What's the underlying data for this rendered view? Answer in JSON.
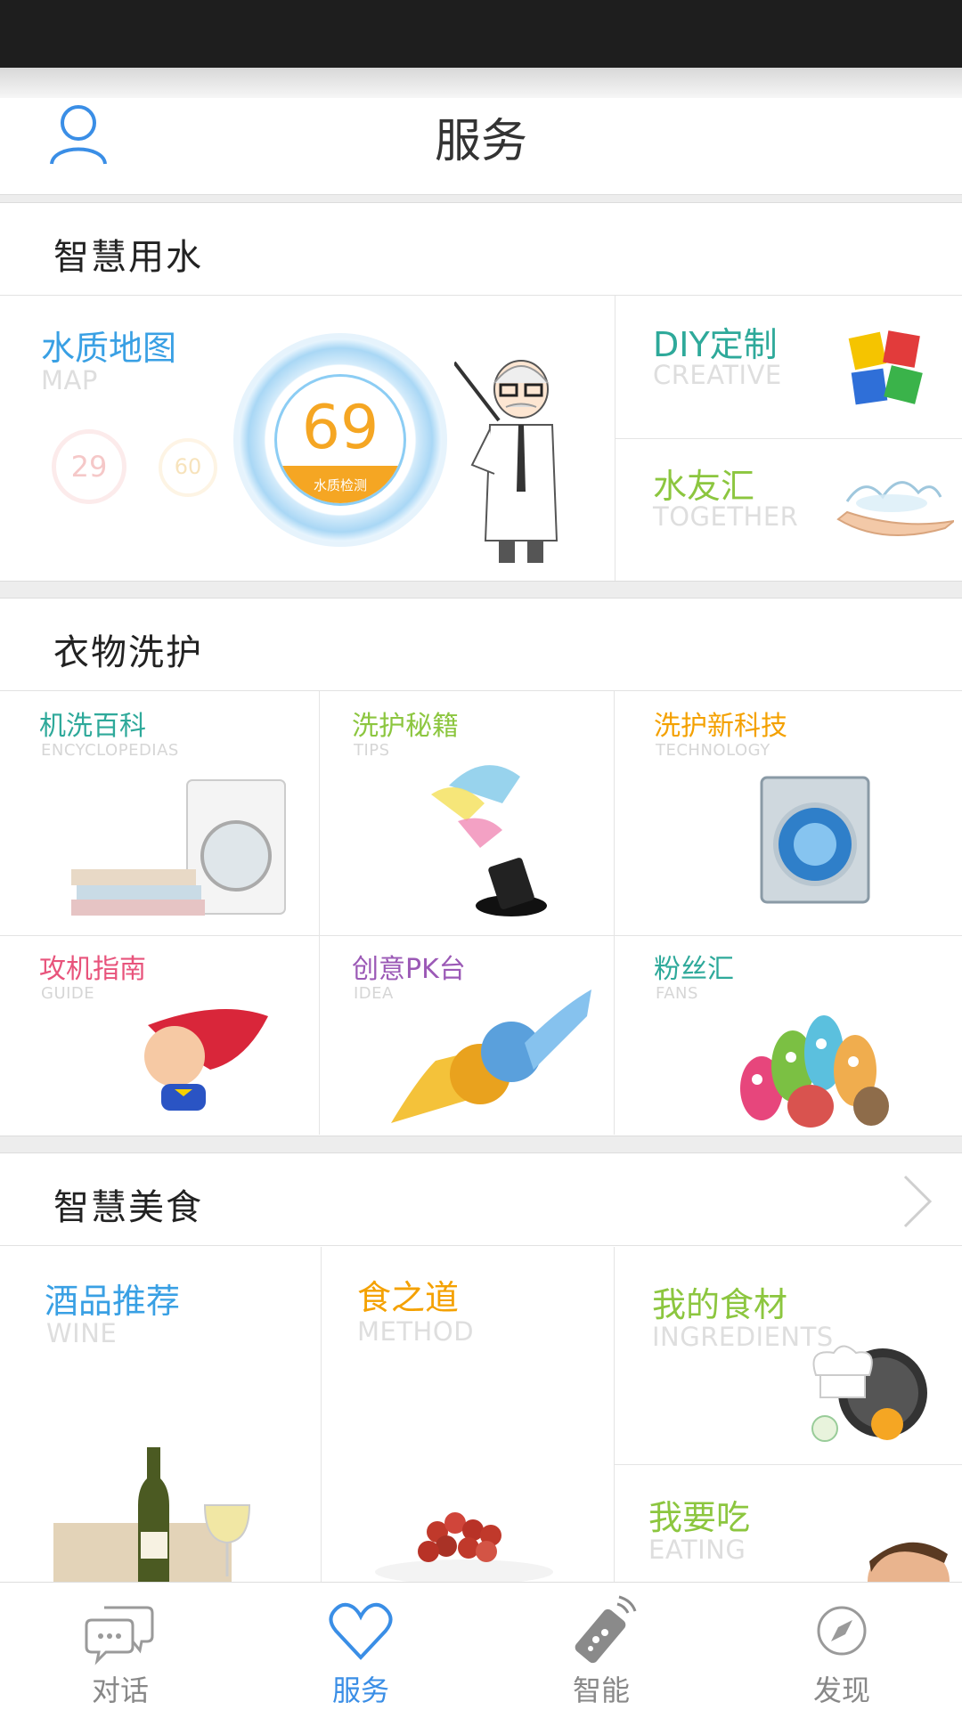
{
  "header": {
    "title": "服务",
    "user_icon": "user-icon"
  },
  "colors": {
    "accent": "#3a8ee6",
    "water_blue": "#39a0e4",
    "teal": "#2ea99a",
    "green": "#8cc63f",
    "orange": "#f4a100",
    "pink": "#e8547c",
    "purple": "#9b59b6"
  },
  "water": {
    "section_title": "智慧用水",
    "map": {
      "title_zh": "水质地图",
      "title_en": "MAP",
      "score": "69",
      "score_label": "水质检测",
      "small_left": "29",
      "small_right": "60"
    },
    "diy": {
      "title_zh": "DIY定制",
      "title_en": "CREATIVE"
    },
    "together": {
      "title_zh": "水友汇",
      "title_en": "TOGETHER"
    }
  },
  "laundry": {
    "section_title": "衣物洗护",
    "items": [
      {
        "zh": "机洗百科",
        "en": "ENCYCLOPEDIAS",
        "color": "#2ea99a",
        "icon": "washing-machine-icon"
      },
      {
        "zh": "洗护秘籍",
        "en": "TIPS",
        "color": "#8cc63f",
        "icon": "magic-hat-icon"
      },
      {
        "zh": "洗护新科技",
        "en": "TECHNOLOGY",
        "color": "#f4a100",
        "icon": "tech-washer-icon"
      },
      {
        "zh": "攻机指南",
        "en": "GUIDE",
        "color": "#e8547c",
        "icon": "superhero-baby-icon"
      },
      {
        "zh": "创意PK台",
        "en": "IDEA",
        "color": "#9b59b6",
        "icon": "fists-icon"
      },
      {
        "zh": "粉丝汇",
        "en": "FANS",
        "color": "#2ea99a",
        "icon": "monsters-icon"
      }
    ]
  },
  "food": {
    "section_title": "智慧美食",
    "items": [
      {
        "zh": "酒品推荐",
        "en": "WINE",
        "color": "#39a0e4",
        "icon": "wine-bottle-icon"
      },
      {
        "zh": "食之道",
        "en": "METHOD",
        "color": "#f4a100",
        "icon": "food-plate-icon"
      },
      {
        "zh": "我的食材",
        "en": "INGREDIENTS",
        "color": "#8cc63f",
        "icon": "chef-pan-icon"
      },
      {
        "zh": "我要吃",
        "en": "EATING",
        "color": "#8cc63f",
        "icon": "eating-face-icon"
      }
    ]
  },
  "tabs": [
    {
      "label": "对话",
      "icon": "chat-icon",
      "active": false
    },
    {
      "label": "服务",
      "icon": "heart-icon",
      "active": true
    },
    {
      "label": "智能",
      "icon": "remote-icon",
      "active": false
    },
    {
      "label": "发现",
      "icon": "compass-icon",
      "active": false
    }
  ]
}
